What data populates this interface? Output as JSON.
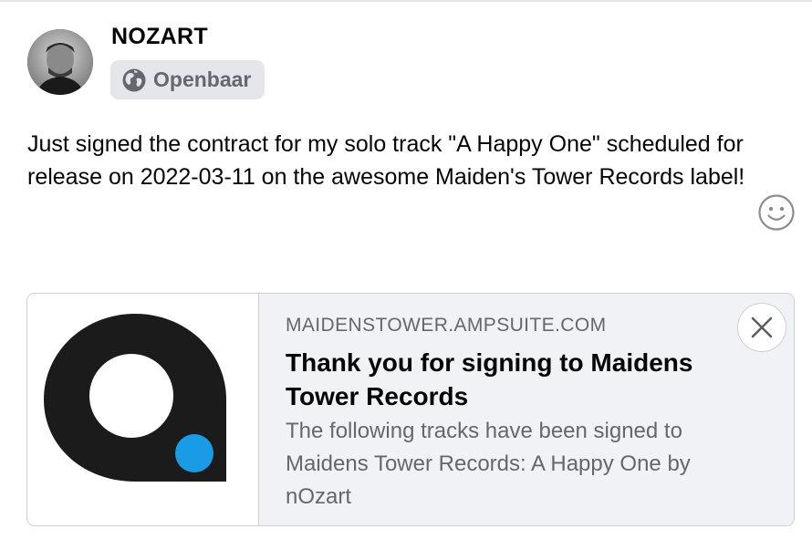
{
  "post": {
    "author_name": "NOZART",
    "audience": {
      "label": "Openbaar",
      "icon": "globe-icon"
    },
    "text": "Just signed the contract for my solo track \"A Happy One\" scheduled for release on 2022-03-11 on the awesome Maiden's Tower Records label!",
    "emoji_button_icon": "smiley-icon"
  },
  "link_preview": {
    "domain": "MAIDENSTOWER.AMPSUITE.COM",
    "title": "Thank you for signing to Maidens Tower Records",
    "description": "The following tracks have been signed to Maidens Tower Records: A Happy One by nOzart",
    "close_icon": "close-icon",
    "thumbnail_icon": "ampsuite-logo"
  },
  "colors": {
    "logo_dark": "#1b1b1b",
    "logo_accent": "#1a9be6",
    "pill_background": "#e4e6eb",
    "card_background": "#f0f2f5",
    "secondary_text": "#65676b"
  }
}
